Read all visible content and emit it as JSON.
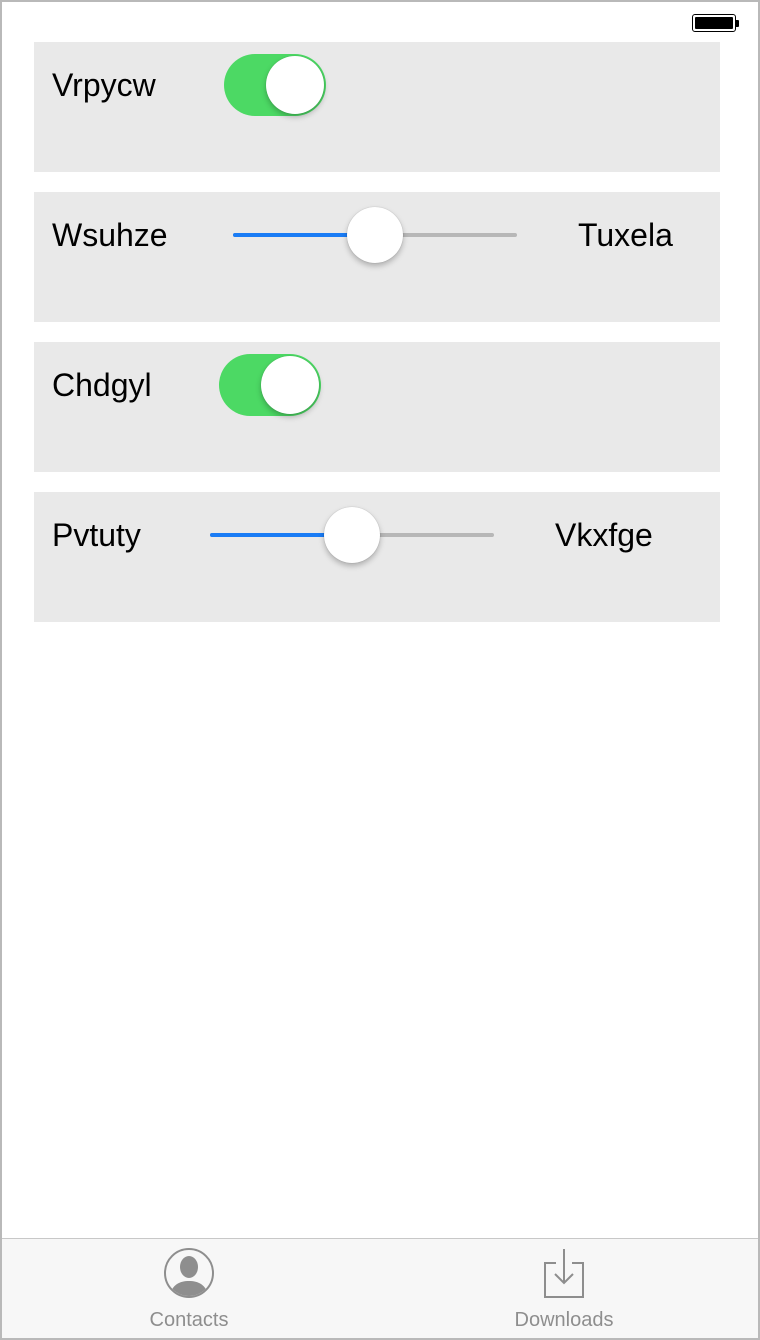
{
  "status_bar": {
    "battery_icon": "battery-full-icon"
  },
  "rows": [
    {
      "kind": "toggle",
      "label": "Vrpycw",
      "on": true
    },
    {
      "kind": "slider",
      "label": "Wsuhze",
      "value_label": "Tuxela",
      "value": 0.5
    },
    {
      "kind": "toggle",
      "label": "Chdgyl",
      "on": true
    },
    {
      "kind": "slider",
      "label": "Pvtuty",
      "value_label": "Vkxfge",
      "value": 0.5
    }
  ],
  "tabbar": {
    "tabs": [
      {
        "label": "Contacts",
        "icon": "person-circle-icon"
      },
      {
        "label": "Downloads",
        "icon": "download-tray-icon"
      }
    ]
  },
  "colors": {
    "toggle_on": "#4cd964",
    "slider_fill": "#1a7cf5",
    "card_bg": "#e9e9e9",
    "tab_inactive": "#8e8e8e"
  }
}
